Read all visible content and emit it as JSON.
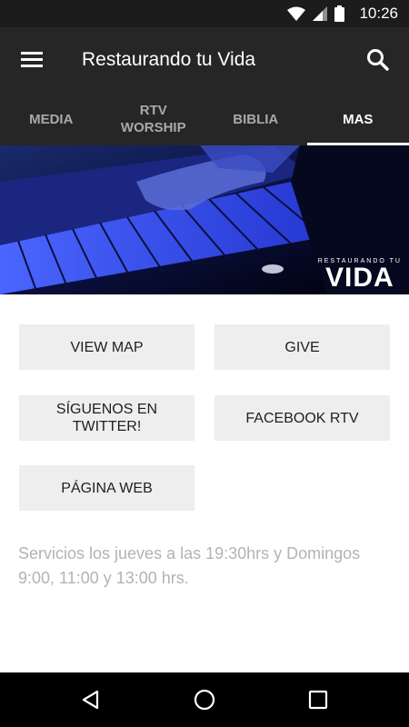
{
  "status": {
    "time": "10:26"
  },
  "app_bar": {
    "title": "Restaurando tu Vida"
  },
  "tabs": [
    {
      "label": "MEDIA"
    },
    {
      "label": "RTV\nWORSHIP"
    },
    {
      "label": "BIBLIA"
    },
    {
      "label": "MAS"
    }
  ],
  "hero": {
    "logo_small": "RESTAURANDO TU",
    "logo_big": "VIDA"
  },
  "buttons": {
    "view_map": "VIEW MAP",
    "give": "GIVE",
    "twitter": "SÍGUENOS EN\nTWITTER!",
    "facebook": "FACEBOOK RTV",
    "web": "PÁGINA WEB"
  },
  "info_text": "Servicios los jueves a las 19:30hrs y Domingos 9:00, 11:00 y 13:00 hrs.",
  "colors": {
    "app_bar": "#262626",
    "status_bar": "#1c1c1c",
    "button_bg": "#eeeeee",
    "info_text": "#b3b3b3"
  }
}
